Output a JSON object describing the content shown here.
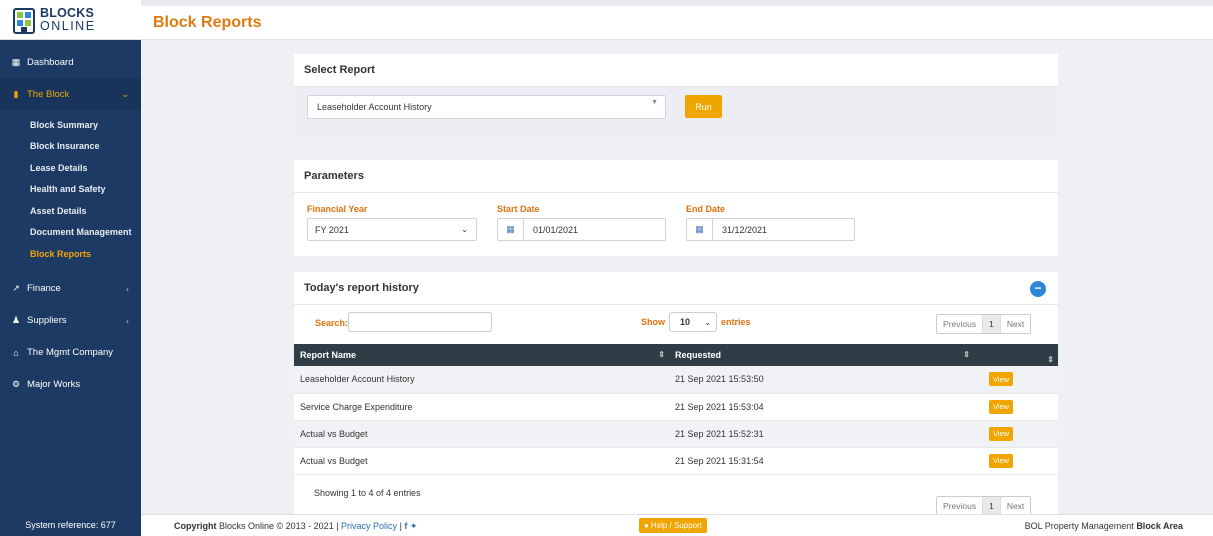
{
  "logo": {
    "line1": "BLOCKS",
    "line2": "ONLINE"
  },
  "sidebar": {
    "items": [
      {
        "label": "Dashboard",
        "icon": "dashboard-icon"
      },
      {
        "label": "The Block",
        "icon": "building-icon",
        "active": true
      },
      {
        "label": "Finance",
        "icon": "chart-icon"
      },
      {
        "label": "Suppliers",
        "icon": "users-icon"
      },
      {
        "label": "The Mgmt Company",
        "icon": "bank-icon"
      },
      {
        "label": "Major Works",
        "icon": "cogs-icon"
      }
    ],
    "subitems": [
      "Block Summary",
      "Block Insurance",
      "Lease Details",
      "Health and Safety",
      "Asset Details",
      "Document Management",
      "Block Reports"
    ],
    "system_ref": "System reference: 677"
  },
  "header": {
    "title": "Block Reports"
  },
  "select_report": {
    "title": "Select Report",
    "selected": "Leaseholder Account History",
    "run_label": "Run"
  },
  "parameters": {
    "title": "Parameters",
    "financial_year_label": "Financial Year",
    "financial_year_value": "FY 2021",
    "start_date_label": "Start Date",
    "start_date_value": "01/01/2021",
    "end_date_label": "End Date",
    "end_date_value": "31/12/2021"
  },
  "history": {
    "title": "Today's report history",
    "search_label": "Search:",
    "show_label": "Show",
    "show_value": "10",
    "entries_label": "entries",
    "pager": {
      "prev": "Previous",
      "page": "1",
      "next": "Next"
    },
    "columns": [
      "Report Name",
      "Requested",
      ""
    ],
    "rows": [
      {
        "name": "Leaseholder Account History",
        "requested": "21 Sep 2021 15:53:50",
        "action": "View"
      },
      {
        "name": "Service Charge Expenditure",
        "requested": "21 Sep 2021 15:53:04",
        "action": "View"
      },
      {
        "name": "Actual vs Budget",
        "requested": "21 Sep 2021 15:52:31",
        "action": "View"
      },
      {
        "name": "Actual vs Budget",
        "requested": "21 Sep 2021 15:31:54",
        "action": "View"
      }
    ],
    "showing": "Showing 1 to 4 of 4 entries"
  },
  "footer": {
    "copyright_bold": "Copyright",
    "copyright_text": " Blocks Online © 2013 - 2021 | ",
    "privacy": "Privacy Policy",
    "separator": " | ",
    "help": "Help / Support",
    "right_text": "BOL Property Management ",
    "right_bold": "Block Area"
  },
  "colors": {
    "accent": "#f0a500",
    "sidebar": "#1c3a63",
    "title": "#e07b11",
    "table_head": "#2f3e46"
  }
}
